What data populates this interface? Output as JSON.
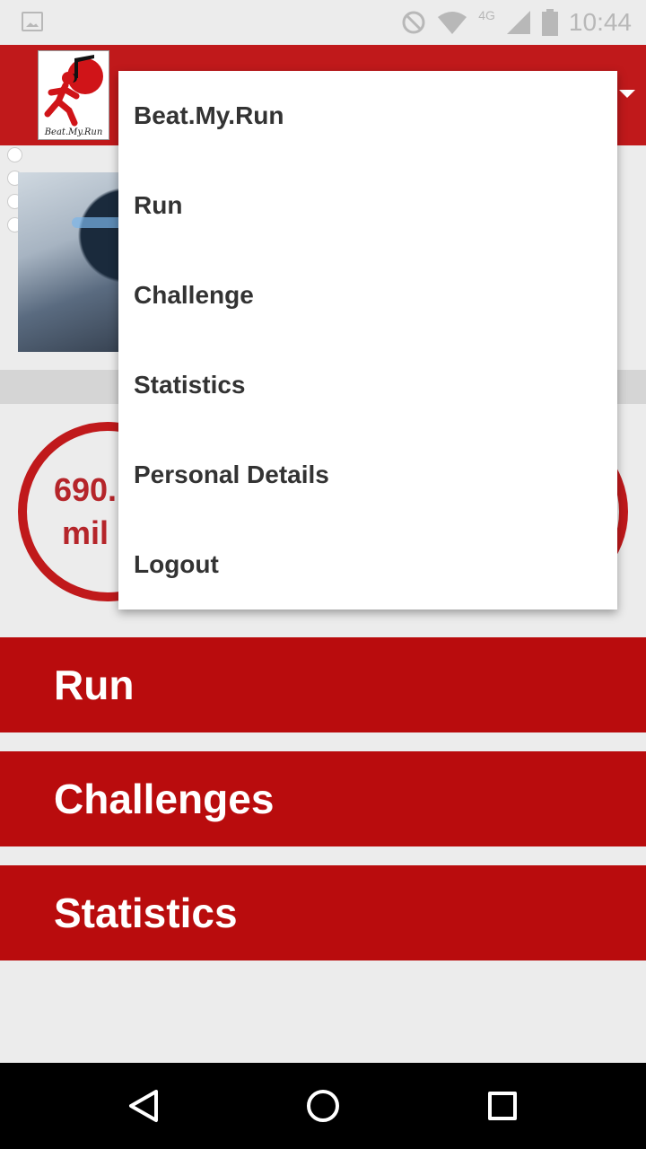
{
  "status_bar": {
    "time": "10:44",
    "network": "4G",
    "icons": [
      "image-icon",
      "do-not-disturb-icon",
      "wifi-icon",
      "signal-icon",
      "battery-icon"
    ]
  },
  "app_bar": {
    "logo_caption": "Beat.My.Run",
    "color": "#c0191b"
  },
  "profile": {
    "distance_partial": "690.",
    "unit_partial": "mil"
  },
  "main_buttons": {
    "run": "Run",
    "challenges": "Challenges",
    "statistics": "Statistics",
    "color": "#b90c0d"
  },
  "menu": {
    "items": [
      {
        "label": "Beat.My.Run"
      },
      {
        "label": "Run"
      },
      {
        "label": "Challenge"
      },
      {
        "label": "Statistics"
      },
      {
        "label": "Personal Details"
      },
      {
        "label": "Logout"
      }
    ]
  },
  "nav_bar": {
    "icons": [
      "back-icon",
      "home-icon",
      "recents-icon"
    ]
  }
}
